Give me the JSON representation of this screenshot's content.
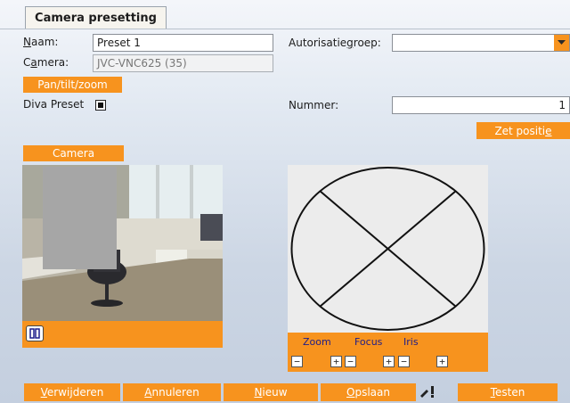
{
  "tab": {
    "title": "Camera presetting"
  },
  "form": {
    "naam_label": "Naam:",
    "naam_value": "Preset 1",
    "camera_label": "Camera:",
    "camera_value": "JVC-VNC625 (35)",
    "autorisatie_label": "Autorisatiegroep:",
    "autorisatie_value": "",
    "pan_tilt_zoom_label": "Pan/tilt/zoom",
    "diva_preset_label": "Diva Preset",
    "diva_preset_checked": true,
    "nummer_label": "Nummer:",
    "nummer_value": "1",
    "zet_positie_label": "Zet positie"
  },
  "camera_section": {
    "label": "Camera",
    "pause_icon": "pause-icon"
  },
  "ptz": {
    "zoom_label": "Zoom",
    "focus_label": "Focus",
    "iris_label": "Iris",
    "minus": "−",
    "plus": "+"
  },
  "buttons": {
    "verwijderen": "Verwijderen",
    "annuleren": "Annuleren",
    "nieuw": "Nieuw",
    "opslaan": "Opslaan",
    "testen": "Testen"
  },
  "icons": {
    "edit": "pencil-exclamation-icon"
  },
  "colors": {
    "accent": "#f7931e",
    "background": "#dfe6ef"
  }
}
